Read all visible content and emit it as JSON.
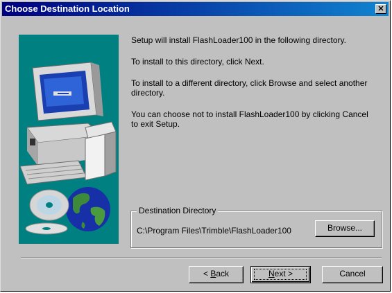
{
  "window": {
    "title": "Choose Destination Location",
    "close_glyph": "✕"
  },
  "body": {
    "line1": "Setup will install FlashLoader100 in the following directory.",
    "line2": "To install to this directory, click Next.",
    "line3a": "To install to a different directory, click Browse and select another",
    "line3b": "directory.",
    "line4a": "You can choose not to install FlashLoader100 by clicking Cancel",
    "line4b": "to exit Setup."
  },
  "destination": {
    "group_label": "Destination Directory",
    "path": "C:\\Program Files\\Trimble\\FlashLoader100",
    "browse_label": "Browse..."
  },
  "buttons": {
    "back_prefix": "< ",
    "back_mnemonic": "B",
    "back_rest": "ack",
    "next_mnemonic": "N",
    "next_rest": "ext >",
    "cancel": "Cancel"
  },
  "icons": {
    "art": "computer-and-globe-illustration",
    "close": "close-icon"
  },
  "colors": {
    "titlebar_start": "#000080",
    "titlebar_end": "#1084d0",
    "panel_teal": "#008080",
    "dialog_bg": "#c0c0c0"
  }
}
